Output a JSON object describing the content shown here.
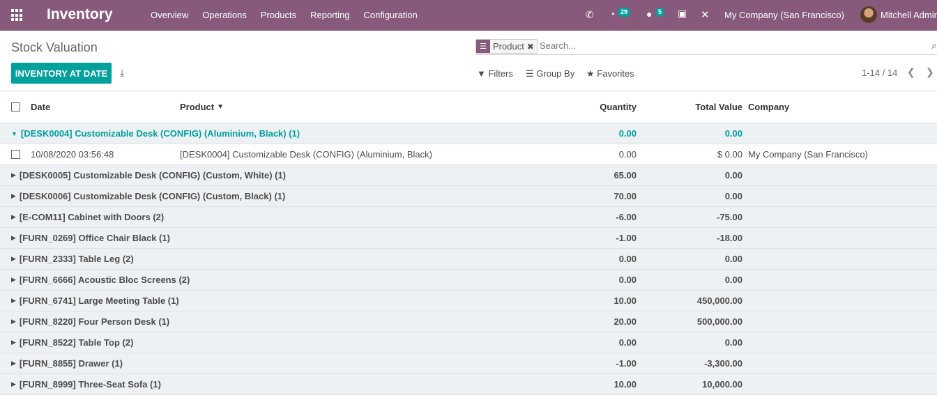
{
  "navbar": {
    "brand": "Inventory",
    "menu": [
      "Overview",
      "Operations",
      "Products",
      "Reporting",
      "Configuration"
    ],
    "activity_count": "29",
    "message_count": "5",
    "company": "My Company (San Francisco)",
    "user": "Mitchell Admin",
    "color": "#875a7b"
  },
  "control": {
    "title": "Stock Valuation",
    "facet_label": "Product",
    "facet_remove": "✖",
    "search_placeholder": "Search...",
    "primary_button": "INVENTORY AT DATE",
    "filters": "Filters",
    "group_by": "Group By",
    "favorites": "Favorites",
    "pager": "1-14 / 14",
    "accent": "#00a09d"
  },
  "table": {
    "columns": {
      "date": "Date",
      "product": "Product",
      "quantity": "Quantity",
      "total_value": "Total Value",
      "company": "Company"
    },
    "groups": [
      {
        "name": "[DESK0004] Customizable Desk (CONFIG) (Aluminium, Black) (1)",
        "qty": "0.00",
        "value": "0.00",
        "open": true
      },
      {
        "name": "[DESK0005] Customizable Desk (CONFIG) (Custom, White) (1)",
        "qty": "65.00",
        "value": "0.00"
      },
      {
        "name": "[DESK0006] Customizable Desk (CONFIG) (Custom, Black) (1)",
        "qty": "70.00",
        "value": "0.00"
      },
      {
        "name": "[E-COM11] Cabinet with Doors (2)",
        "qty": "-6.00",
        "value": "-75.00"
      },
      {
        "name": "[FURN_0269] Office Chair Black (1)",
        "qty": "-1.00",
        "value": "-18.00"
      },
      {
        "name": "[FURN_2333] Table Leg (2)",
        "qty": "0.00",
        "value": "0.00"
      },
      {
        "name": "[FURN_6666] Acoustic Bloc Screens (2)",
        "qty": "0.00",
        "value": "0.00"
      },
      {
        "name": "[FURN_6741] Large Meeting Table (1)",
        "qty": "10.00",
        "value": "450,000.00"
      },
      {
        "name": "[FURN_8220] Four Person Desk (1)",
        "qty": "20.00",
        "value": "500,000.00"
      },
      {
        "name": "[FURN_8522] Table Top (2)",
        "qty": "0.00",
        "value": "0.00"
      },
      {
        "name": "[FURN_8855] Drawer (1)",
        "qty": "-1.00",
        "value": "-3,300.00"
      },
      {
        "name": "[FURN_8999] Three-Seat Sofa (1)",
        "qty": "10.00",
        "value": "10,000.00"
      }
    ],
    "record": {
      "date": "10/08/2020 03:56:48",
      "product": "[DESK0004] Customizable Desk (CONFIG) (Aluminium, Black)",
      "qty": "0.00",
      "value": "$ 0.00",
      "company": "My Company (San Francisco)"
    }
  }
}
